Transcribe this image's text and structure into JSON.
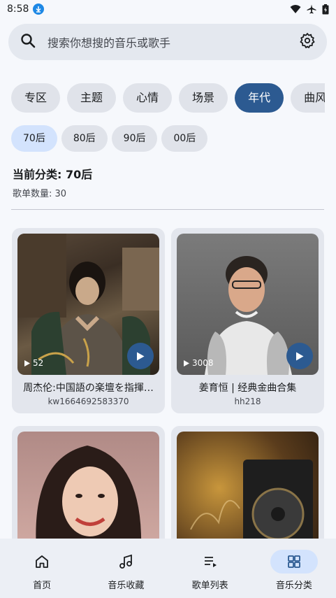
{
  "status": {
    "time": "8:58",
    "icons": [
      "download-icon",
      "wifi-icon",
      "airplane-icon",
      "battery-icon"
    ]
  },
  "search": {
    "placeholder": "搜索你想搜的音乐或歌手",
    "icon": "search-icon",
    "settings_icon": "gear-icon"
  },
  "categories": [
    {
      "label": "专区",
      "active": false
    },
    {
      "label": "主题",
      "active": false
    },
    {
      "label": "心情",
      "active": false
    },
    {
      "label": "场景",
      "active": false
    },
    {
      "label": "年代",
      "active": true
    },
    {
      "label": "曲风",
      "active": false
    }
  ],
  "subcategories": [
    {
      "label": "70后",
      "active": true
    },
    {
      "label": "80后",
      "active": false
    },
    {
      "label": "90后",
      "active": false
    },
    {
      "label": "00后",
      "active": false
    }
  ],
  "info": {
    "current_label": "当前分类: 70后",
    "count_label": "歌单数量: 30"
  },
  "playlists": [
    {
      "title": "周杰伦:中国語の楽壇を指揮…",
      "author": "kw1664692583370",
      "plays": "52"
    },
    {
      "title": "姜育恒 | 经典金曲合集",
      "author": "hh218",
      "plays": "3008"
    },
    {
      "title": "",
      "author": "",
      "plays": ""
    },
    {
      "title": "",
      "author": "",
      "plays": ""
    }
  ],
  "nav": [
    {
      "label": "首页",
      "icon": "home-icon",
      "active": false
    },
    {
      "label": "音乐收藏",
      "icon": "music-note-icon",
      "active": false
    },
    {
      "label": "歌单列表",
      "icon": "playlist-icon",
      "active": false
    },
    {
      "label": "音乐分类",
      "icon": "grid-icon",
      "active": true
    }
  ],
  "colors": {
    "accent": "#2c5a91",
    "accent_light": "#d3e3fd",
    "background": "#f6f8fc"
  }
}
